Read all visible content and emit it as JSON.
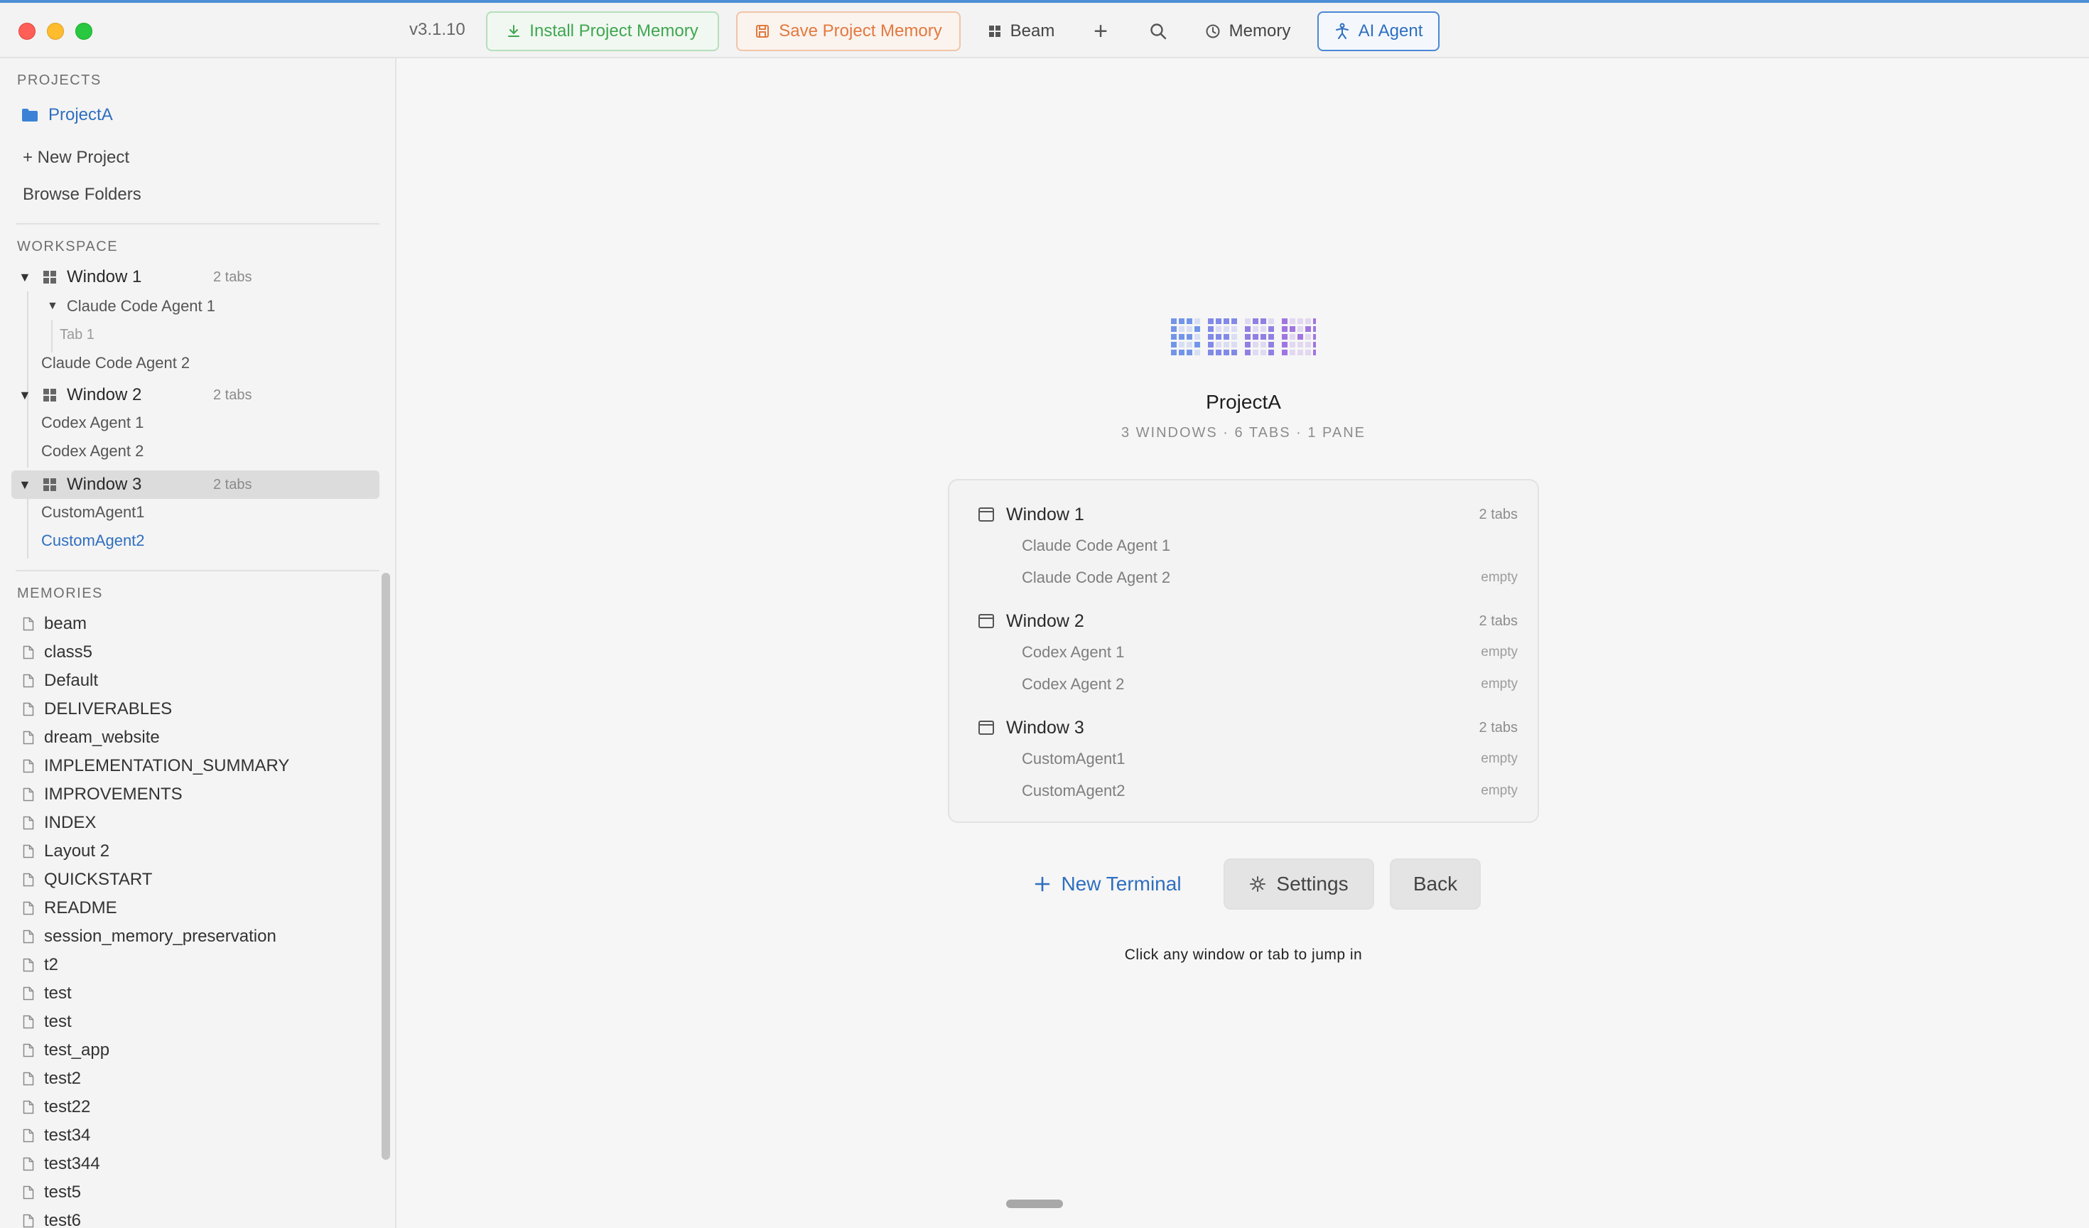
{
  "titlebar": {
    "version": "v3.1.10",
    "install_label": "Install Project Memory",
    "save_label": "Save Project Memory",
    "beam_label": "Beam",
    "plus_label": "+",
    "memory_label": "Memory",
    "agent_label": "AI Agent",
    "colors": {
      "install": "#3fa650",
      "save": "#e2793f",
      "agent": "#2f6fbf"
    }
  },
  "sidebar": {
    "projects_header": "PROJECTS",
    "project_name": "ProjectA",
    "new_project": "+ New Project",
    "browse_folders": "Browse Folders",
    "workspace_header": "WORKSPACE",
    "windows": [
      {
        "name": "Window 1",
        "count": "2 tabs",
        "items": [
          "Claude Code Agent 1",
          "Claude Code Agent 2"
        ],
        "tab": "Tab 1"
      },
      {
        "name": "Window 2",
        "count": "2 tabs",
        "items": [
          "Codex Agent 1",
          "Codex Agent 2"
        ]
      },
      {
        "name": "Window 3",
        "count": "2 tabs",
        "items": [
          "CustomAgent1",
          "CustomAgent2"
        ]
      }
    ],
    "memories_header": "MEMORIES",
    "memories": [
      "beam",
      "class5",
      "Default",
      "DELIVERABLES",
      "dream_website",
      "IMPLEMENTATION_SUMMARY",
      "IMPROVEMENTS",
      "INDEX",
      "Layout 2",
      "QUICKSTART",
      "README",
      "session_memory_preservation",
      "t2",
      "test",
      "test",
      "test_app",
      "test2",
      "test22",
      "test34",
      "test344",
      "test5",
      "test6"
    ]
  },
  "main": {
    "project_title": "ProjectA",
    "stats": "3 WINDOWS · 6 TABS · 1 PANE",
    "windows": [
      {
        "name": "Window 1",
        "count": "2 tabs",
        "tabs": [
          {
            "name": "Claude Code Agent 1",
            "state": ""
          },
          {
            "name": "Claude Code Agent 2",
            "state": "empty"
          }
        ]
      },
      {
        "name": "Window 2",
        "count": "2 tabs",
        "tabs": [
          {
            "name": "Codex Agent 1",
            "state": "empty"
          },
          {
            "name": "Codex Agent 2",
            "state": "empty"
          }
        ]
      },
      {
        "name": "Window 3",
        "count": "2 tabs",
        "tabs": [
          {
            "name": "CustomAgent1",
            "state": "empty"
          },
          {
            "name": "CustomAgent2",
            "state": "empty"
          }
        ]
      }
    ],
    "new_terminal": "New Terminal",
    "settings": "Settings",
    "back": "Back",
    "hint": "Click any window or tab to jump in"
  }
}
